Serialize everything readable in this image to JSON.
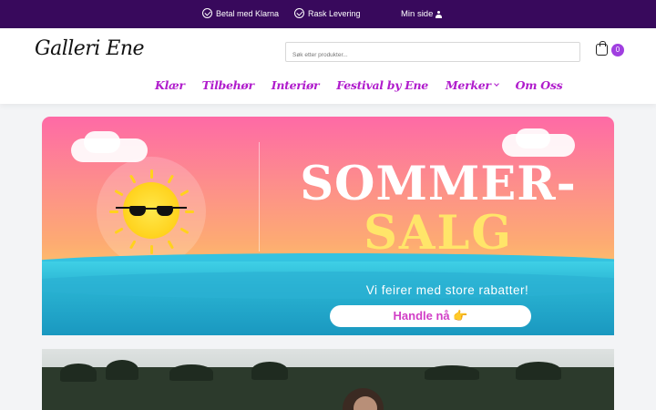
{
  "topbar": {
    "usps": [
      "Betal med Klarna",
      "Rask Levering"
    ],
    "account_label": "Min side"
  },
  "header": {
    "logo_text": "Galleri Ene",
    "search_placeholder": "Søk etter produkter...",
    "cart_count": "0"
  },
  "nav": {
    "items": [
      "Klær",
      "Tilbehør",
      "Interiør",
      "Festival by Ene",
      "Merker",
      "Om Oss"
    ]
  },
  "hero": {
    "title_line1": "SOMMER-",
    "title_line2": "SALG",
    "subtitle": "Vi feirer med store rabatter!",
    "cta_label": "Handle nå 👉"
  },
  "colors": {
    "topbar": "#38095c",
    "accent": "#b01ccc",
    "cart_badge": "#a03fe0"
  }
}
